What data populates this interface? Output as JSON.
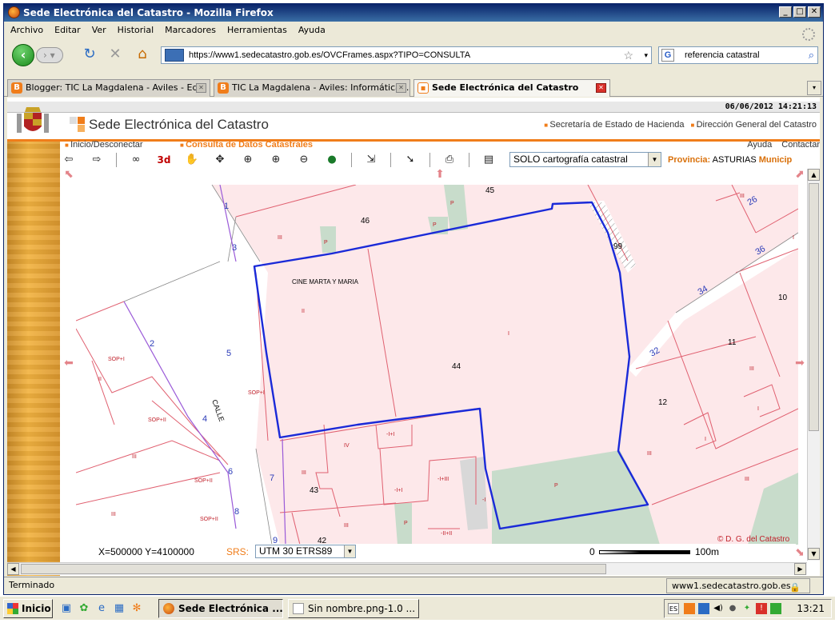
{
  "window": {
    "title": "Sede Electrónica del Catastro - Mozilla Firefox"
  },
  "menu": [
    "Archivo",
    "Editar",
    "Ver",
    "Historial",
    "Marcadores",
    "Herramientas",
    "Ayuda"
  ],
  "nav": {
    "url": "https://www1.sedecatastro.gob.es/OVCFrames.aspx?TIPO=CONSULTA",
    "search_value": "referencia catastral"
  },
  "tabs": [
    {
      "label": "Blogger: TIC La Magdalena - Aviles - Ed...",
      "icon": "blogger-icon"
    },
    {
      "label": "TIC La Magdalena - Aviles: Informática ...",
      "icon": "blogger-icon"
    },
    {
      "label": "Sede Electrónica del Catastro",
      "icon": "catastro-icon"
    }
  ],
  "page": {
    "datetime": "06/06/2012  14:21:13",
    "site_title": "Sede Electrónica del Catastro",
    "top_links": [
      "Secretaría de Estado de Hacienda",
      "Dirección General del Catastro"
    ],
    "nav_inicio": "Inicio/Desconectar",
    "nav_consulta": "Consulta de Datos Catastrales",
    "nav_right": [
      "Ayuda",
      "Contactar"
    ],
    "layer_select": "SOLO cartografía catastral",
    "provincia_label": "Provincia:",
    "provincia_value": "ASTURIAS",
    "municipio_label": "Municip"
  },
  "toolbar_icons": [
    "back-arrow-icon",
    "forward-arrow-icon",
    "binoculars-icon",
    "3d-icon",
    "hand-pan-icon",
    "move-icon",
    "zoom-box-icon",
    "zoom-in-icon",
    "zoom-out-icon",
    "globe-icon",
    "measure-icon",
    "info-pointer-icon",
    "print-icon",
    "legend-icon"
  ],
  "toolbar_3d_label": "3d",
  "map": {
    "labels": {
      "cine": "CINE MARTA Y MARIA",
      "calle": "CALLE",
      "copyright": "© D. G. del Catastro"
    },
    "parcel_numbers": [
      "45",
      "46",
      "99",
      "44",
      "43",
      "42",
      "10",
      "11",
      "12"
    ],
    "street_numbers": [
      "1",
      "3",
      "2",
      "5",
      "4",
      "6",
      "8",
      "7",
      "9",
      "26",
      "36",
      "34",
      "32"
    ],
    "floor_codes": [
      "III",
      "P",
      "II",
      "I",
      "SOP+I",
      "SOP+II",
      "IV",
      "-I+I",
      "-I+III",
      "-II+II",
      "-I"
    ],
    "colors": {
      "parcel_fill": "#fde8ea",
      "parcel_line": "#e06070",
      "selected_outline": "#1a2ad8",
      "green_area": "#c8dccb",
      "street_number_color": "#2a3ab8"
    }
  },
  "coords": {
    "xy": "X=500000 Y=4100000",
    "srs_label": "SRS:",
    "srs_value": "UTM 30 ETRS89",
    "scale_start": "0",
    "scale_end": "100m"
  },
  "status": {
    "text": "Terminado",
    "url": "www1.sedecatastro.gob.es"
  },
  "taskbar": {
    "start": "Inicio",
    "buttons": [
      "Sede Electrónica ...",
      "Sin nombre.png-1.0 ..."
    ],
    "clock": "13:21",
    "lang": "ES"
  }
}
